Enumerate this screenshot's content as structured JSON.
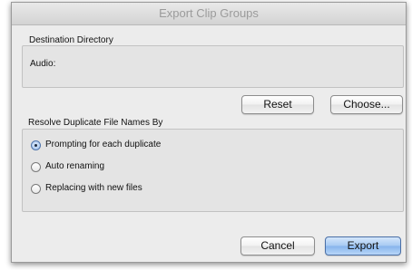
{
  "window": {
    "title": "Export Clip Groups"
  },
  "destination": {
    "label": "Destination Directory",
    "value": "Audio:",
    "reset_label": "Reset",
    "choose_label": "Choose..."
  },
  "resolve": {
    "label": "Resolve Duplicate File Names By",
    "options": [
      {
        "label": "Prompting for each duplicate",
        "selected": true
      },
      {
        "label": "Auto renaming",
        "selected": false
      },
      {
        "label": "Replacing with new files",
        "selected": false
      }
    ]
  },
  "footer": {
    "cancel_label": "Cancel",
    "export_label": "Export"
  },
  "colors": {
    "default_button_accent": "#86b4ec"
  }
}
